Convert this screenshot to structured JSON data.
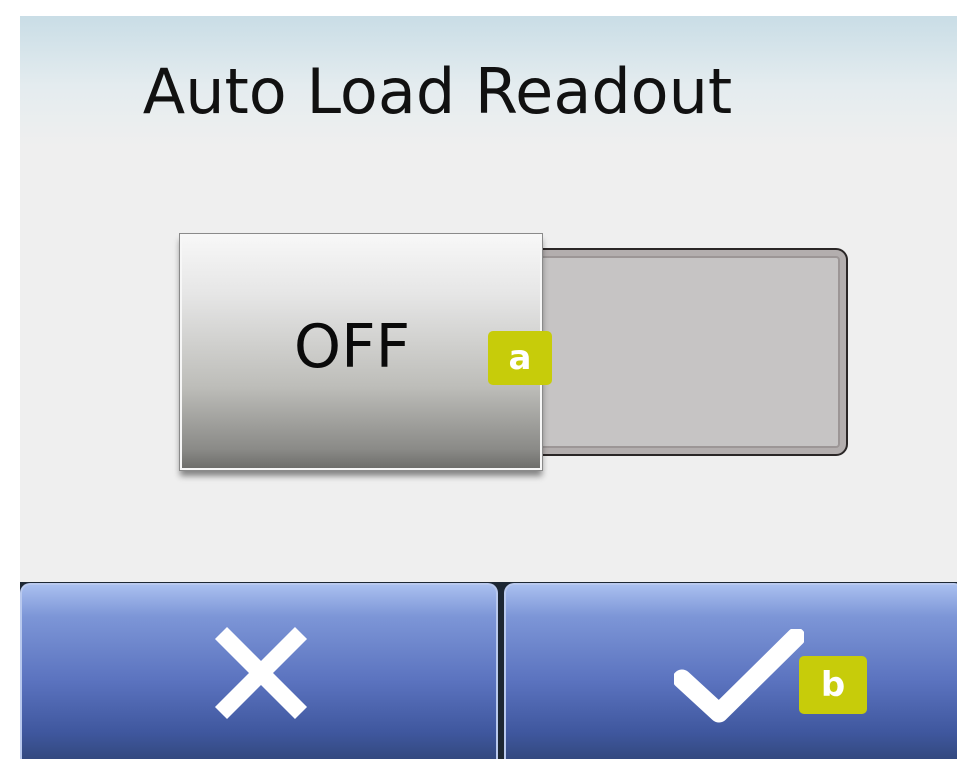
{
  "screen": {
    "title": "Auto Load Readout"
  },
  "toggle": {
    "state_label": "OFF",
    "is_on": false
  },
  "callouts": {
    "a": "a",
    "b": "b"
  },
  "actions": {
    "cancel_icon": "close-icon",
    "confirm_icon": "checkmark-icon"
  },
  "colors": {
    "callout": "#c7cc0a",
    "button_top": "#a9bfef",
    "button_bottom": "#33497f",
    "background": "#efefef"
  }
}
